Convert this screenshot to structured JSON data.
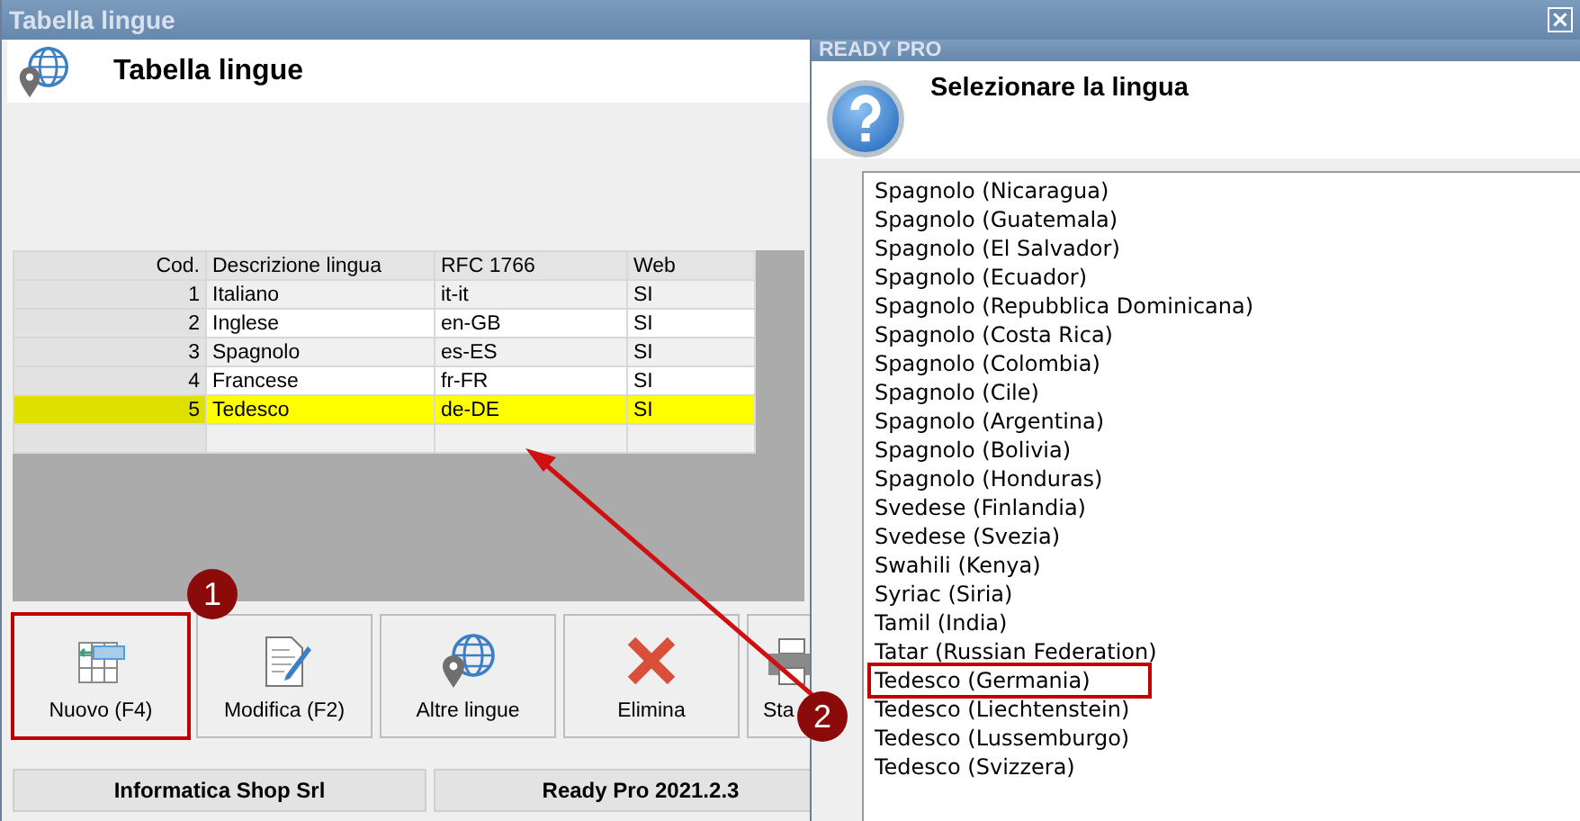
{
  "window": {
    "title": "Tabella lingue",
    "close": "×"
  },
  "header": {
    "title": "Tabella lingue"
  },
  "table": {
    "columns": [
      "Cod.",
      "Descrizione lingua",
      "RFC 1766",
      "Web"
    ],
    "rows": [
      {
        "cells": [
          "1",
          "Italiano",
          "it-it",
          "SI"
        ],
        "selected": false
      },
      {
        "cells": [
          "2",
          "Inglese",
          "en-GB",
          "SI"
        ],
        "selected": false
      },
      {
        "cells": [
          "3",
          "Spagnolo",
          "es-ES",
          "SI"
        ],
        "selected": false
      },
      {
        "cells": [
          "4",
          "Francese",
          "fr-FR",
          "SI"
        ],
        "selected": false
      },
      {
        "cells": [
          "5",
          "Tedesco",
          "de-DE",
          "SI"
        ],
        "selected": true
      }
    ]
  },
  "buttons": [
    {
      "label": "Nuovo (F4)",
      "kind": "new",
      "annotated": true
    },
    {
      "label": "Modifica (F2)",
      "kind": "edit",
      "annotated": false
    },
    {
      "label": "Altre lingue",
      "kind": "globe",
      "annotated": false
    },
    {
      "label": "Elimina",
      "kind": "delete",
      "annotated": false
    },
    {
      "label": "Sta",
      "kind": "print",
      "annotated": false
    }
  ],
  "status_bar": [
    "Informatica Shop Srl",
    "Ready Pro 2021.2.3"
  ],
  "dialog": {
    "title": "READY PRO",
    "heading": "Selezionare la lingua",
    "items": [
      {
        "label": "Spagnolo (Nicaragua)",
        "annotated": false
      },
      {
        "label": "Spagnolo (Guatemala)",
        "annotated": false
      },
      {
        "label": "Spagnolo (El Salvador)",
        "annotated": false
      },
      {
        "label": "Spagnolo (Ecuador)",
        "annotated": false
      },
      {
        "label": "Spagnolo (Repubblica Dominicana)",
        "annotated": false
      },
      {
        "label": "Spagnolo (Costa Rica)",
        "annotated": false
      },
      {
        "label": "Spagnolo (Colombia)",
        "annotated": false
      },
      {
        "label": "Spagnolo (Cile)",
        "annotated": false
      },
      {
        "label": "Spagnolo (Argentina)",
        "annotated": false
      },
      {
        "label": "Spagnolo (Bolivia)",
        "annotated": false
      },
      {
        "label": "Spagnolo (Honduras)",
        "annotated": false
      },
      {
        "label": "Svedese (Finlandia)",
        "annotated": false
      },
      {
        "label": "Svedese (Svezia)",
        "annotated": false
      },
      {
        "label": "Swahili (Kenya)",
        "annotated": false
      },
      {
        "label": "Syriac (Siria)",
        "annotated": false
      },
      {
        "label": "Tamil (India)",
        "annotated": false
      },
      {
        "label": "Tatar (Russian Federation)",
        "annotated": false
      },
      {
        "label": "Tedesco (Germania)",
        "annotated": true
      },
      {
        "label": "Tedesco (Liechtenstein)",
        "annotated": false
      },
      {
        "label": "Tedesco (Lussemburgo)",
        "annotated": false
      },
      {
        "label": "Tedesco (Svizzera)",
        "annotated": false
      }
    ]
  },
  "annotations": [
    "1",
    "2"
  ]
}
